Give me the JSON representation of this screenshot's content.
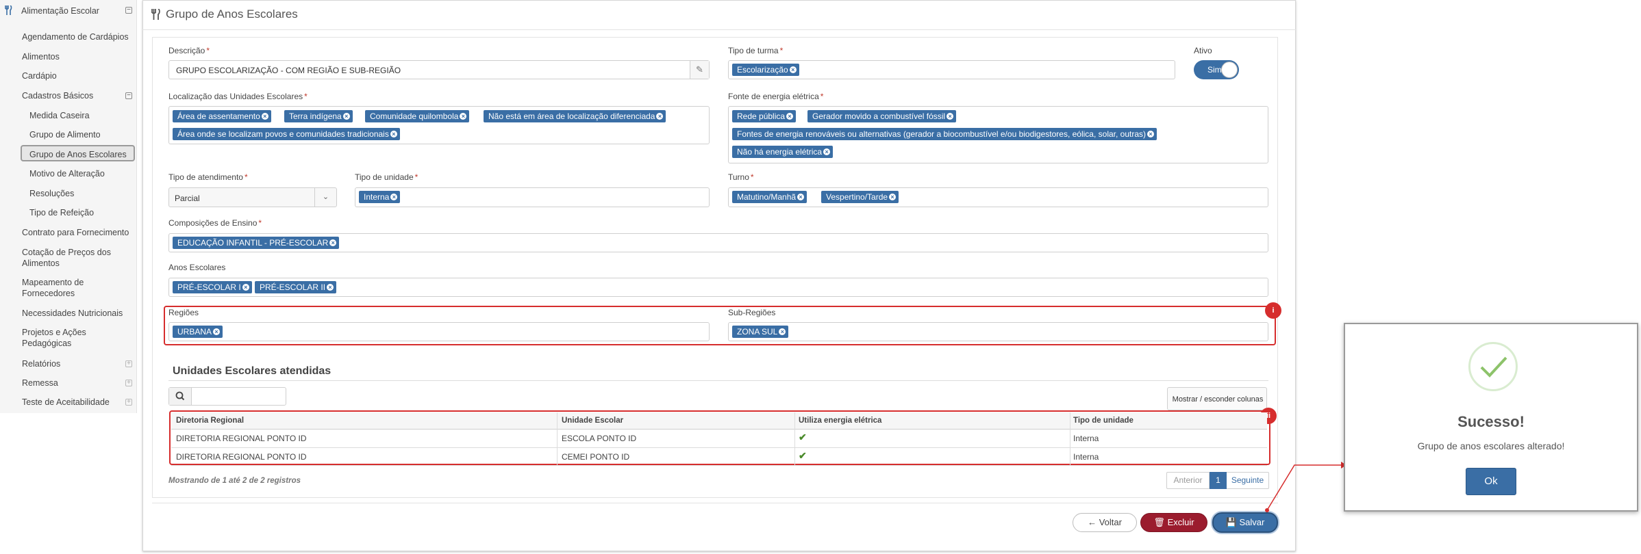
{
  "sidebar": {
    "items": [
      {
        "label": "Alimentação Escolar"
      },
      {
        "label": "Agendamento de Cardápios"
      },
      {
        "label": "Alimentos"
      },
      {
        "label": "Cardápio"
      },
      {
        "label": "Cadastros Básicos"
      },
      {
        "label": "Medida Caseira"
      },
      {
        "label": "Grupo de Alimento"
      },
      {
        "label": "Grupo de Anos Escolares"
      },
      {
        "label": "Motivo de Alteração"
      },
      {
        "label": "Resoluções"
      },
      {
        "label": "Tipo de Refeição"
      },
      {
        "label": "Contrato para Fornecimento"
      },
      {
        "label": "Cotação de Preços dos"
      },
      {
        "label": "Alimentos"
      },
      {
        "label": "Mapeamento de"
      },
      {
        "label": "Fornecedores"
      },
      {
        "label": "Necessidades Nutricionais"
      },
      {
        "label": "Projetos e Ações"
      },
      {
        "label": "Pedagógicas"
      },
      {
        "label": "Relatórios"
      },
      {
        "label": "Remessa"
      },
      {
        "label": "Teste de Aceitabilidade"
      }
    ],
    "toggles": {
      "collapse": "⊟",
      "expand": "⊞"
    }
  },
  "header": {
    "title": "Grupo de Anos Escolares"
  },
  "form": {
    "descricao": {
      "label": "Descrição",
      "value": "GRUPO ESCOLARIZAÇÃO - COM REGIÃO E SUB-REGIÃO"
    },
    "tipo_turma": {
      "label": "Tipo de turma",
      "tags": [
        "Escolarização"
      ]
    },
    "ativo": {
      "label": "Ativo",
      "value": "Sim"
    },
    "localizacao": {
      "label": "Localização das Unidades Escolares",
      "tags": [
        "Área de assentamento",
        "Terra indígena",
        "Comunidade quilombola",
        "Não está em área de localização diferenciada",
        "Área onde se localizam povos e comunidades tradicionais"
      ]
    },
    "fonte_energia": {
      "label": "Fonte de energia elétrica",
      "tags": [
        "Rede pública",
        "Gerador movido a combustível fóssil",
        "Fontes de energia renováveis ou alternativas (gerador a biocombustível e/ou biodigestores, eólica, solar, outras)",
        "Não há energia elétrica"
      ]
    },
    "tipo_atendimento": {
      "label": "Tipo de atendimento",
      "value": "Parcial"
    },
    "tipo_unidade": {
      "label": "Tipo de unidade",
      "tags": [
        "Interna"
      ]
    },
    "turno": {
      "label": "Turno",
      "tags": [
        "Matutino/Manhã",
        "Vespertino/Tarde"
      ]
    },
    "composicoes": {
      "label": "Composições de Ensino",
      "tags": [
        "EDUCAÇÃO INFANTIL - PRÉ-ESCOLAR"
      ]
    },
    "anos": {
      "label": "Anos Escolares",
      "tags": [
        "PRÉ-ESCOLAR I",
        "PRÉ-ESCOLAR II"
      ]
    },
    "regioes": {
      "label": "Regiões",
      "tags": [
        "URBANA"
      ]
    },
    "sub_regioes": {
      "label": "Sub-Regiões",
      "tags": [
        "ZONA SUL"
      ]
    }
  },
  "annotations": {
    "i": "i",
    "ii": "ii"
  },
  "unidades": {
    "title": "Unidades Escolares atendidas",
    "columns_button": "Mostrar / esconder colunas",
    "headers": [
      "Diretoria Regional",
      "Unidade Escolar",
      "Utiliza energia elétrica",
      "Tipo de unidade"
    ],
    "rows": [
      [
        "DIRETORIA REGIONAL PONTO ID",
        "ESCOLA PONTO ID",
        "✔",
        "Interna"
      ],
      [
        "DIRETORIA REGIONAL PONTO ID",
        "CEMEI PONTO ID",
        "✔",
        "Interna"
      ]
    ],
    "info": "Mostrando de 1 até 2 de 2 registros",
    "pagination": {
      "prev": "Anterior",
      "page": "1",
      "next": "Seguinte"
    }
  },
  "buttons": {
    "voltar": "Voltar",
    "excluir": "Excluir",
    "salvar": "Salvar"
  },
  "dialog": {
    "title": "Sucesso!",
    "message": "Grupo de anos escolares alterado!",
    "ok": "Ok"
  }
}
